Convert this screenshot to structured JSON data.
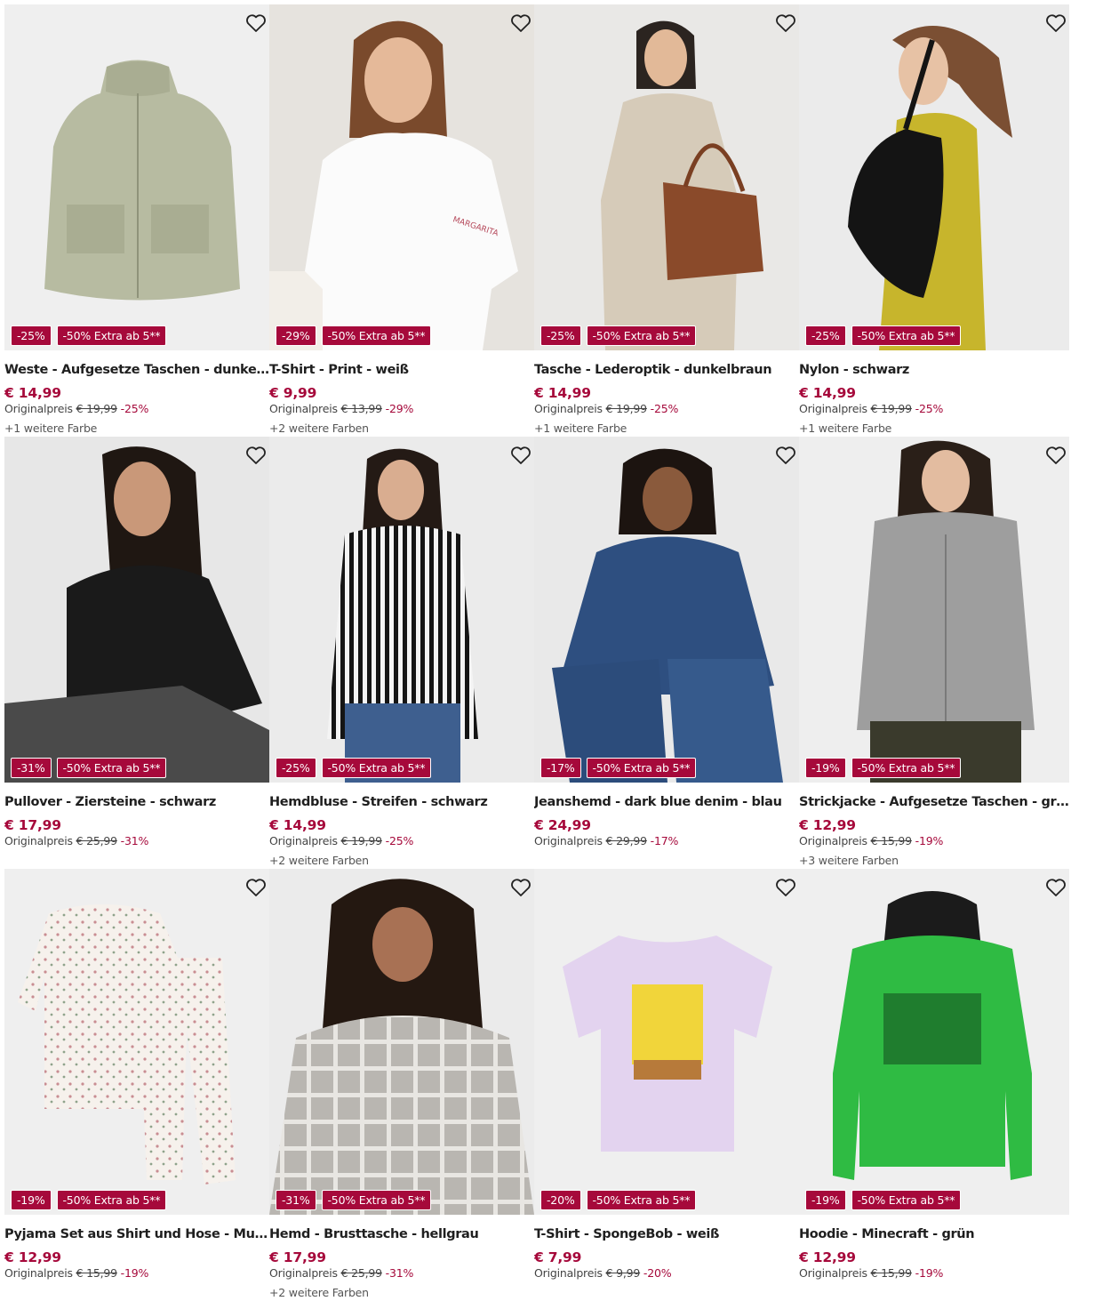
{
  "theme": {
    "accent": "#a6093b",
    "badge_text": "#ffffff",
    "image_bg": "#eeeeee"
  },
  "products": [
    {
      "name": "Weste - Aufgesetze Taschen - dunkelgrün",
      "price": "€ 14,99",
      "original_label": "Originalpreis",
      "original_price": "€ 19,99",
      "discount": "-25%",
      "badge_discount": "-25%",
      "badge_extra": "-50% Extra ab 5**",
      "colors": "+1 weitere Farbe",
      "wishlist_icon": "heart-outline-icon"
    },
    {
      "name": "T-Shirt - Print - weiß",
      "price": "€ 9,99",
      "original_label": "Originalpreis",
      "original_price": "€ 13,99",
      "discount": "-29%",
      "badge_discount": "-29%",
      "badge_extra": "-50% Extra ab 5**",
      "colors": "+2 weitere Farben",
      "wishlist_icon": "heart-outline-icon"
    },
    {
      "name": "Tasche - Lederoptik - dunkelbraun",
      "price": "€ 14,99",
      "original_label": "Originalpreis",
      "original_price": "€ 19,99",
      "discount": "-25%",
      "badge_discount": "-25%",
      "badge_extra": "-50% Extra ab 5**",
      "colors": "+1 weitere Farbe",
      "wishlist_icon": "heart-outline-icon"
    },
    {
      "name": "Nylon - schwarz",
      "price": "€ 14,99",
      "original_label": "Originalpreis",
      "original_price": "€ 19,99",
      "discount": "-25%",
      "badge_discount": "-25%",
      "badge_extra": "-50% Extra ab 5**",
      "colors": "+1 weitere Farbe",
      "wishlist_icon": "heart-outline-icon"
    },
    {
      "name": "Pullover - Ziersteine - schwarz",
      "price": "€ 17,99",
      "original_label": "Originalpreis",
      "original_price": "€ 25,99",
      "discount": "-31%",
      "badge_discount": "-31%",
      "badge_extra": "-50% Extra ab 5**",
      "colors": "",
      "wishlist_icon": "heart-outline-icon"
    },
    {
      "name": "Hemdbluse - Streifen - schwarz",
      "price": "€ 14,99",
      "original_label": "Originalpreis",
      "original_price": "€ 19,99",
      "discount": "-25%",
      "badge_discount": "-25%",
      "badge_extra": "-50% Extra ab 5**",
      "colors": "+2 weitere Farben",
      "wishlist_icon": "heart-outline-icon"
    },
    {
      "name": "Jeanshemd - dark blue denim - blau",
      "price": "€ 24,99",
      "original_label": "Originalpreis",
      "original_price": "€ 29,99",
      "discount": "-17%",
      "badge_discount": "-17%",
      "badge_extra": "-50% Extra ab 5**",
      "colors": "",
      "wishlist_icon": "heart-outline-icon"
    },
    {
      "name": "Strickjacke - Aufgesetze Taschen - grau",
      "price": "€ 12,99",
      "original_label": "Originalpreis",
      "original_price": "€ 15,99",
      "discount": "-19%",
      "badge_discount": "-19%",
      "badge_extra": "-50% Extra ab 5**",
      "colors": "+3 weitere Farben",
      "wishlist_icon": "heart-outline-icon"
    },
    {
      "name": "Pyjama Set aus Shirt und Hose - Mustermix - weiß",
      "price": "€ 12,99",
      "original_label": "Originalpreis",
      "original_price": "€ 15,99",
      "discount": "-19%",
      "badge_discount": "-19%",
      "badge_extra": "-50% Extra ab 5**",
      "colors": "",
      "wishlist_icon": "heart-outline-icon"
    },
    {
      "name": "Hemd - Brusttasche - hellgrau",
      "price": "€ 17,99",
      "original_label": "Originalpreis",
      "original_price": "€ 25,99",
      "discount": "-31%",
      "badge_discount": "-31%",
      "badge_extra": "-50% Extra ab 5**",
      "colors": "+2 weitere Farben",
      "wishlist_icon": "heart-outline-icon"
    },
    {
      "name": "T-Shirt - SpongeBob - weiß",
      "price": "€ 7,99",
      "original_label": "Originalpreis",
      "original_price": "€ 9,99",
      "discount": "-20%",
      "badge_discount": "-20%",
      "badge_extra": "-50% Extra ab 5**",
      "colors": "",
      "wishlist_icon": "heart-outline-icon"
    },
    {
      "name": "Hoodie - Minecraft - grün",
      "price": "€ 12,99",
      "original_label": "Originalpreis",
      "original_price": "€ 15,99",
      "discount": "-19%",
      "badge_discount": "-19%",
      "badge_extra": "-50% Extra ab 5**",
      "colors": "",
      "wishlist_icon": "heart-outline-icon"
    }
  ]
}
